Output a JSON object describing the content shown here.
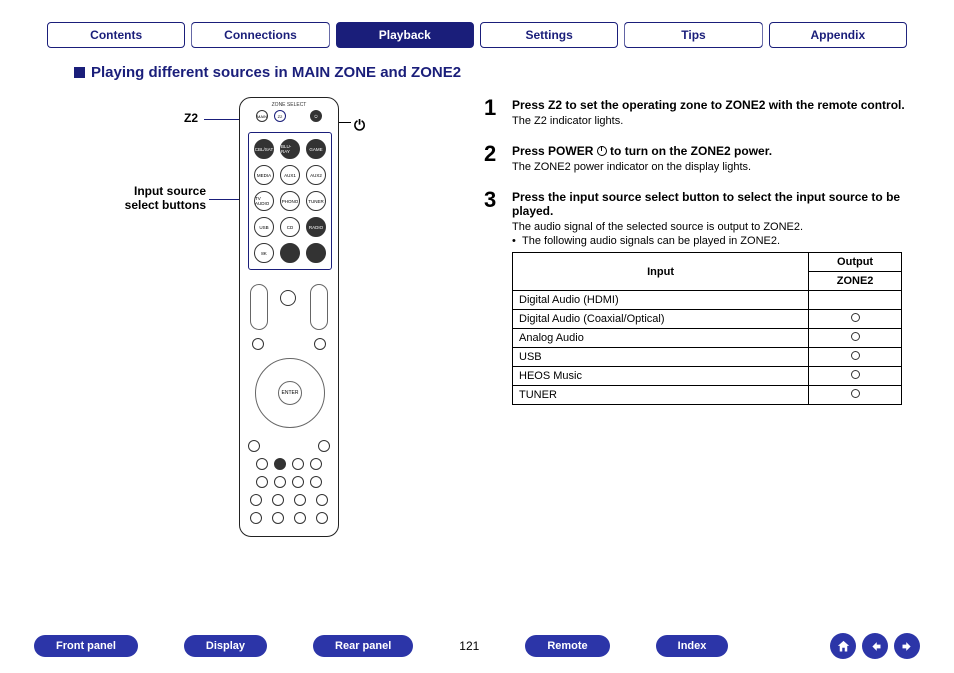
{
  "tabs": {
    "contents": "Contents",
    "connections": "Connections",
    "playback": "Playback",
    "settings": "Settings",
    "tips": "Tips",
    "appendix": "Appendix"
  },
  "section_title": "Playing different sources in MAIN ZONE and ZONE2",
  "remote": {
    "label_z2": "Z2",
    "label_inputs": "Input source\nselect buttons",
    "power_glyph": "⏻",
    "zone_select": "ZONE SELECT",
    "main": "MAIN",
    "z2btn": "Z2",
    "src": [
      "CBL/SAT",
      "BLU-RAY",
      "GAME",
      "MEDIA",
      "AUX1",
      "AUX2",
      "TV AUDIO",
      "PHONO",
      "TUNER",
      "USB",
      "CD",
      "RADIO",
      "8K",
      "—",
      "—"
    ],
    "enter": "ENTER"
  },
  "steps": [
    {
      "num": "1",
      "title": "Press Z2 to set the operating zone to ZONE2 with the remote control.",
      "desc": "The Z2 indicator lights."
    },
    {
      "num": "2",
      "title_pre": "Press POWER ",
      "title_post": " to turn on the ZONE2 power.",
      "desc": "The ZONE2 power indicator on the display lights."
    },
    {
      "num": "3",
      "title": "Press the input source select button to select the input source to be played.",
      "desc": "The audio signal of the selected source is output to ZONE2.",
      "bullet": "The following audio signals can be played in ZONE2."
    }
  ],
  "table": {
    "headers": {
      "input": "Input",
      "output": "Output",
      "zone2": "ZONE2"
    },
    "rows": [
      {
        "input": "Digital Audio (HDMI)",
        "zone2": false
      },
      {
        "input": "Digital Audio (Coaxial/Optical)",
        "zone2": true
      },
      {
        "input": "Analog Audio",
        "zone2": true
      },
      {
        "input": "USB",
        "zone2": true
      },
      {
        "input": "HEOS Music",
        "zone2": true
      },
      {
        "input": "TUNER",
        "zone2": true
      }
    ]
  },
  "bottom": {
    "front": "Front panel",
    "display": "Display",
    "rear": "Rear panel",
    "remote": "Remote",
    "index": "Index",
    "page": "121"
  }
}
